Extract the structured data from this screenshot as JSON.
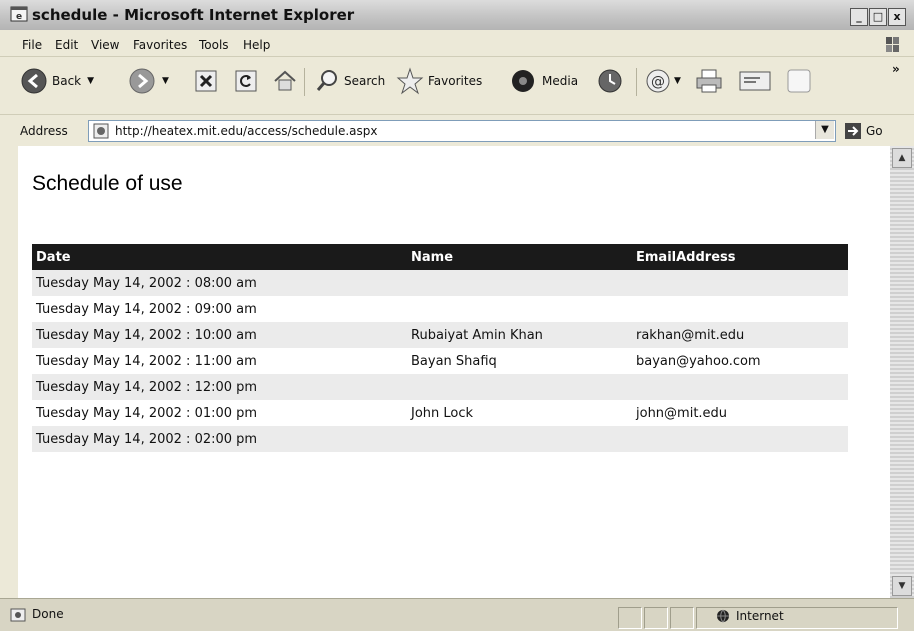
{
  "window": {
    "title": "schedule - Microsoft Internet Explorer",
    "controls": {
      "minimize": "_",
      "maximize": "□",
      "close": "x"
    }
  },
  "menu": {
    "items": [
      {
        "label": "File"
      },
      {
        "label": "Edit"
      },
      {
        "label": "View"
      },
      {
        "label": "Favorites"
      },
      {
        "label": "Tools"
      },
      {
        "label": "Help"
      }
    ]
  },
  "toolbar": {
    "back": "Back",
    "search": "Search",
    "favorites": "Favorites",
    "media": "Media"
  },
  "address": {
    "label": "Address",
    "url": "http://heatex.mit.edu/access/schedule.aspx",
    "go": "Go"
  },
  "page": {
    "title": "Schedule of use",
    "table": {
      "headers": [
        "Date",
        "Name",
        "EmailAddress"
      ],
      "rows": [
        {
          "date": "Tuesday May 14, 2002 : 08:00 am",
          "name": "",
          "email": ""
        },
        {
          "date": "Tuesday May 14, 2002 : 09:00 am",
          "name": "",
          "email": ""
        },
        {
          "date": "Tuesday May 14, 2002 : 10:00 am",
          "name": "Rubaiyat Amin Khan",
          "email": "rakhan@mit.edu"
        },
        {
          "date": "Tuesday May 14, 2002 : 11:00 am",
          "name": "Bayan Shafiq",
          "email": "bayan@yahoo.com"
        },
        {
          "date": "Tuesday May 14, 2002 : 12:00 pm",
          "name": "",
          "email": ""
        },
        {
          "date": "Tuesday May 14, 2002 : 01:00 pm",
          "name": "John Lock",
          "email": "john@mit.edu"
        },
        {
          "date": "Tuesday May 14, 2002 : 02:00 pm",
          "name": "",
          "email": ""
        }
      ]
    }
  },
  "status": {
    "text": "Done",
    "zone": "Internet"
  },
  "colors": {
    "header_bg": "#1a1a1a",
    "alt_row": "#ebebeb"
  }
}
